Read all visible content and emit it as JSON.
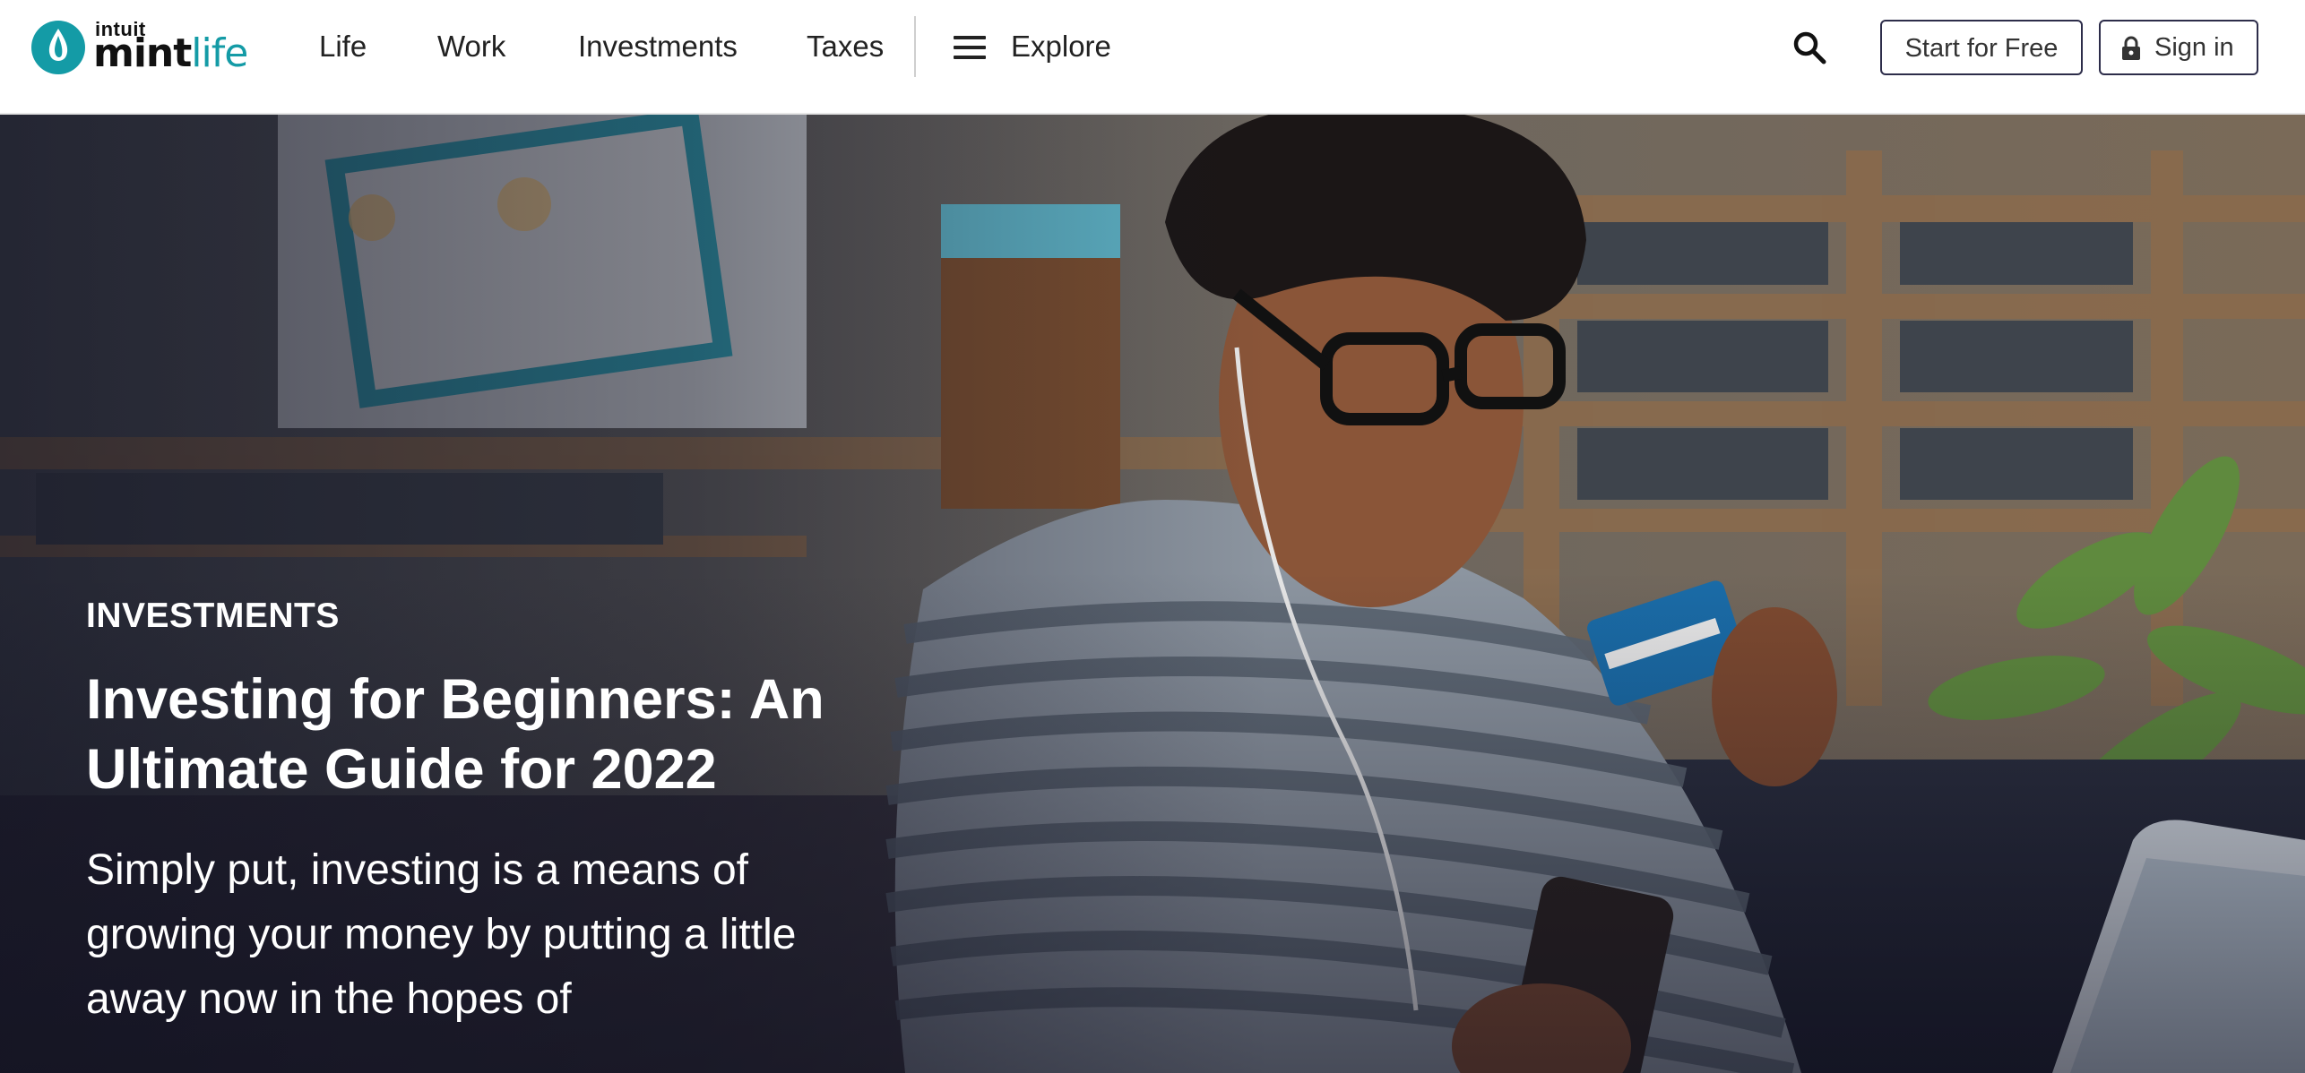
{
  "brand": {
    "top_text": "intuit",
    "word_main": "mint",
    "word_accent": "life",
    "accent_color": "#149ba6"
  },
  "nav": {
    "items": [
      {
        "label": "Life"
      },
      {
        "label": "Work"
      },
      {
        "label": "Investments"
      },
      {
        "label": "Taxes"
      }
    ],
    "explore_label": "Explore",
    "explore_icon": "hamburger-menu-icon",
    "search_icon": "search-icon"
  },
  "actions": {
    "start_label": "Start for Free",
    "signin_label": "Sign in",
    "signin_icon": "lock-icon",
    "border_color": "#2d2d4a"
  },
  "hero": {
    "category": "INVESTMENTS",
    "title": "Investing for Beginners: An Ultimate Guide for 2022",
    "excerpt": "Simply put, investing is a means of growing your money by putting a little away now in the hopes of"
  }
}
